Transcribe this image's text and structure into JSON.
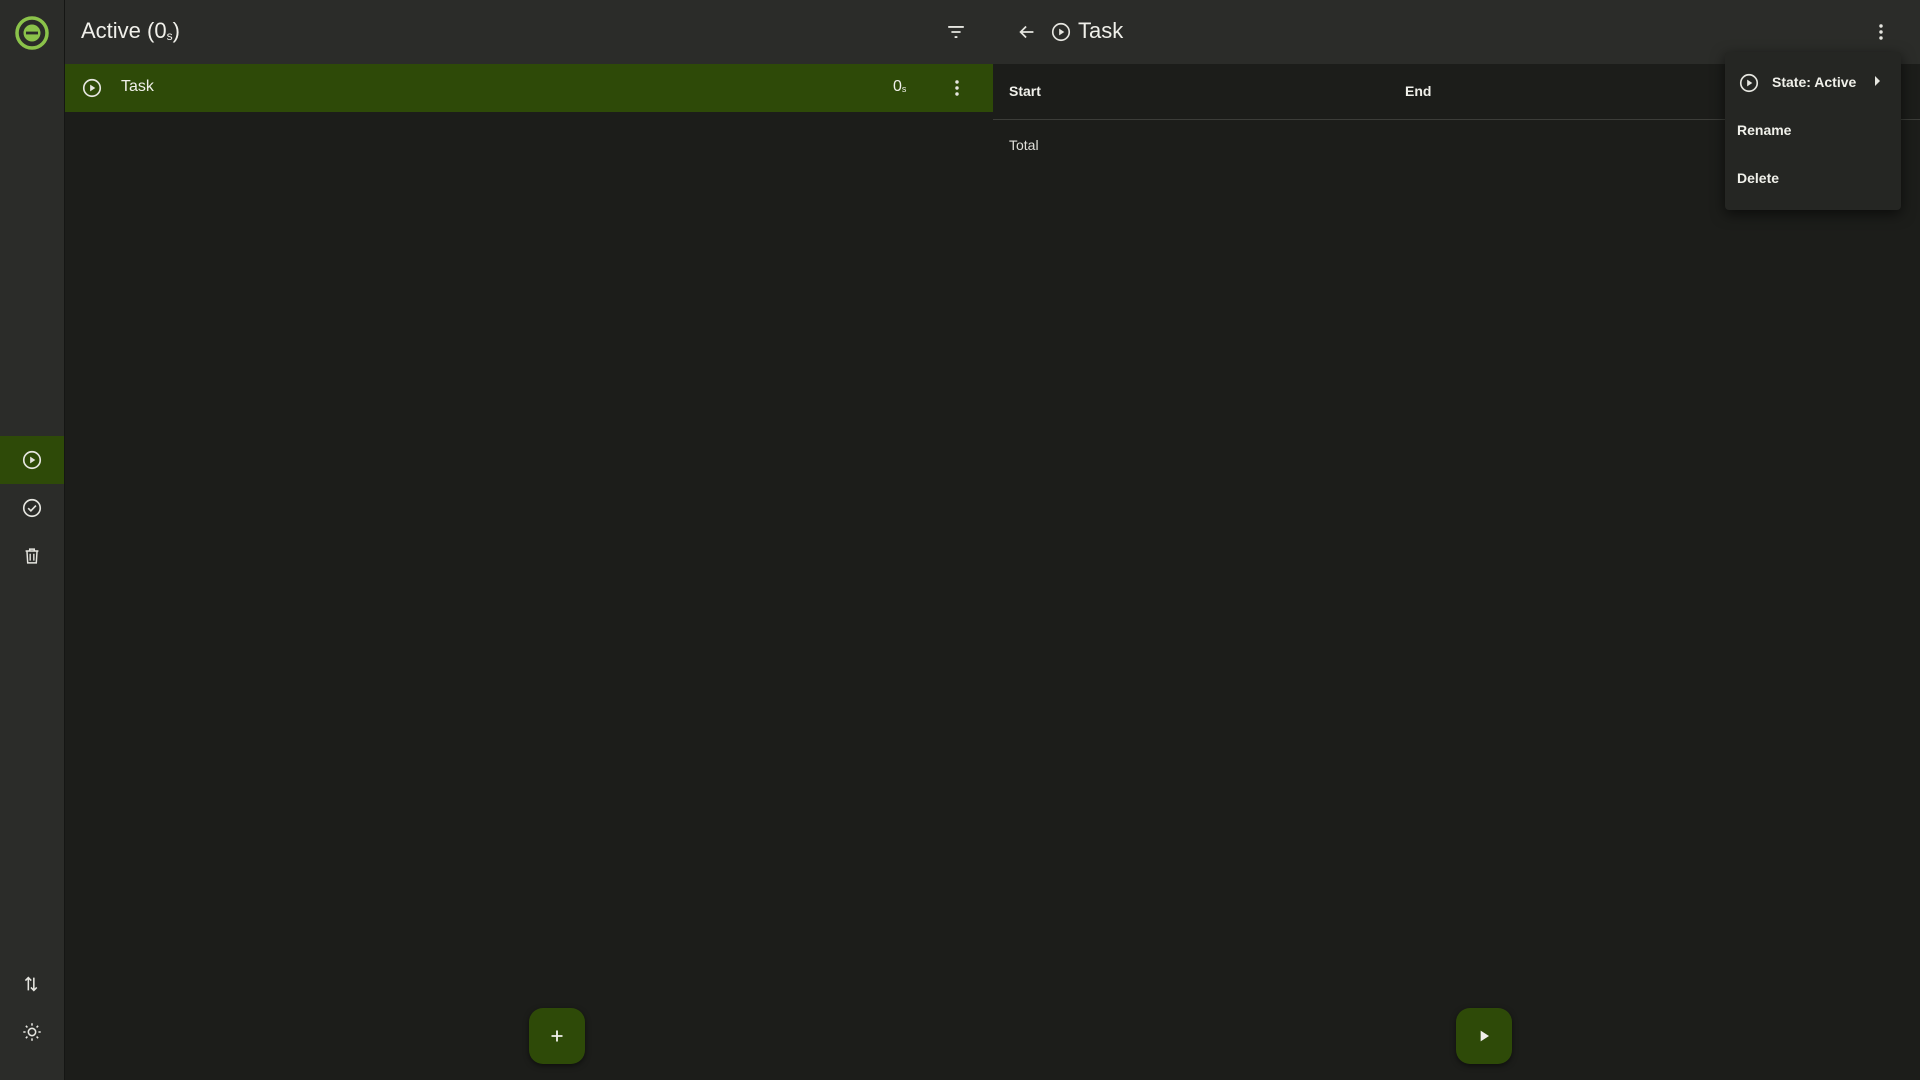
{
  "colors": {
    "accent": "#2e4a08",
    "logo": "#8bc34a",
    "background": "#1c1d1a",
    "surface": "#2b2c29"
  },
  "rail": {
    "logo_icon": "app-logo-icon",
    "items": [
      {
        "name": "active",
        "icon": "play-circle-icon",
        "selected": true
      },
      {
        "name": "completed",
        "icon": "check-circle-icon",
        "selected": false
      },
      {
        "name": "deleted",
        "icon": "trash-icon",
        "selected": false
      }
    ],
    "bottom": [
      {
        "name": "import-export",
        "icon": "swap-vertical-icon"
      },
      {
        "name": "theme",
        "icon": "sun-icon"
      }
    ]
  },
  "list": {
    "title": "Active (0",
    "title_unit": "s",
    "title_close": ")",
    "filter_icon": "filter-icon",
    "tasks": [
      {
        "name": "Task",
        "duration": "0",
        "duration_unit": "s",
        "icon": "play-circle-icon"
      }
    ],
    "add_icon": "plus-icon"
  },
  "detail": {
    "title": "Task",
    "back_icon": "arrow-left-icon",
    "state_icon": "play-circle-icon",
    "columns": {
      "start": "Start",
      "end": "End"
    },
    "total_label": "Total",
    "play_icon": "play-icon"
  },
  "menu": {
    "state_label": "State: Active",
    "rename_label": "Rename",
    "delete_label": "Delete"
  }
}
